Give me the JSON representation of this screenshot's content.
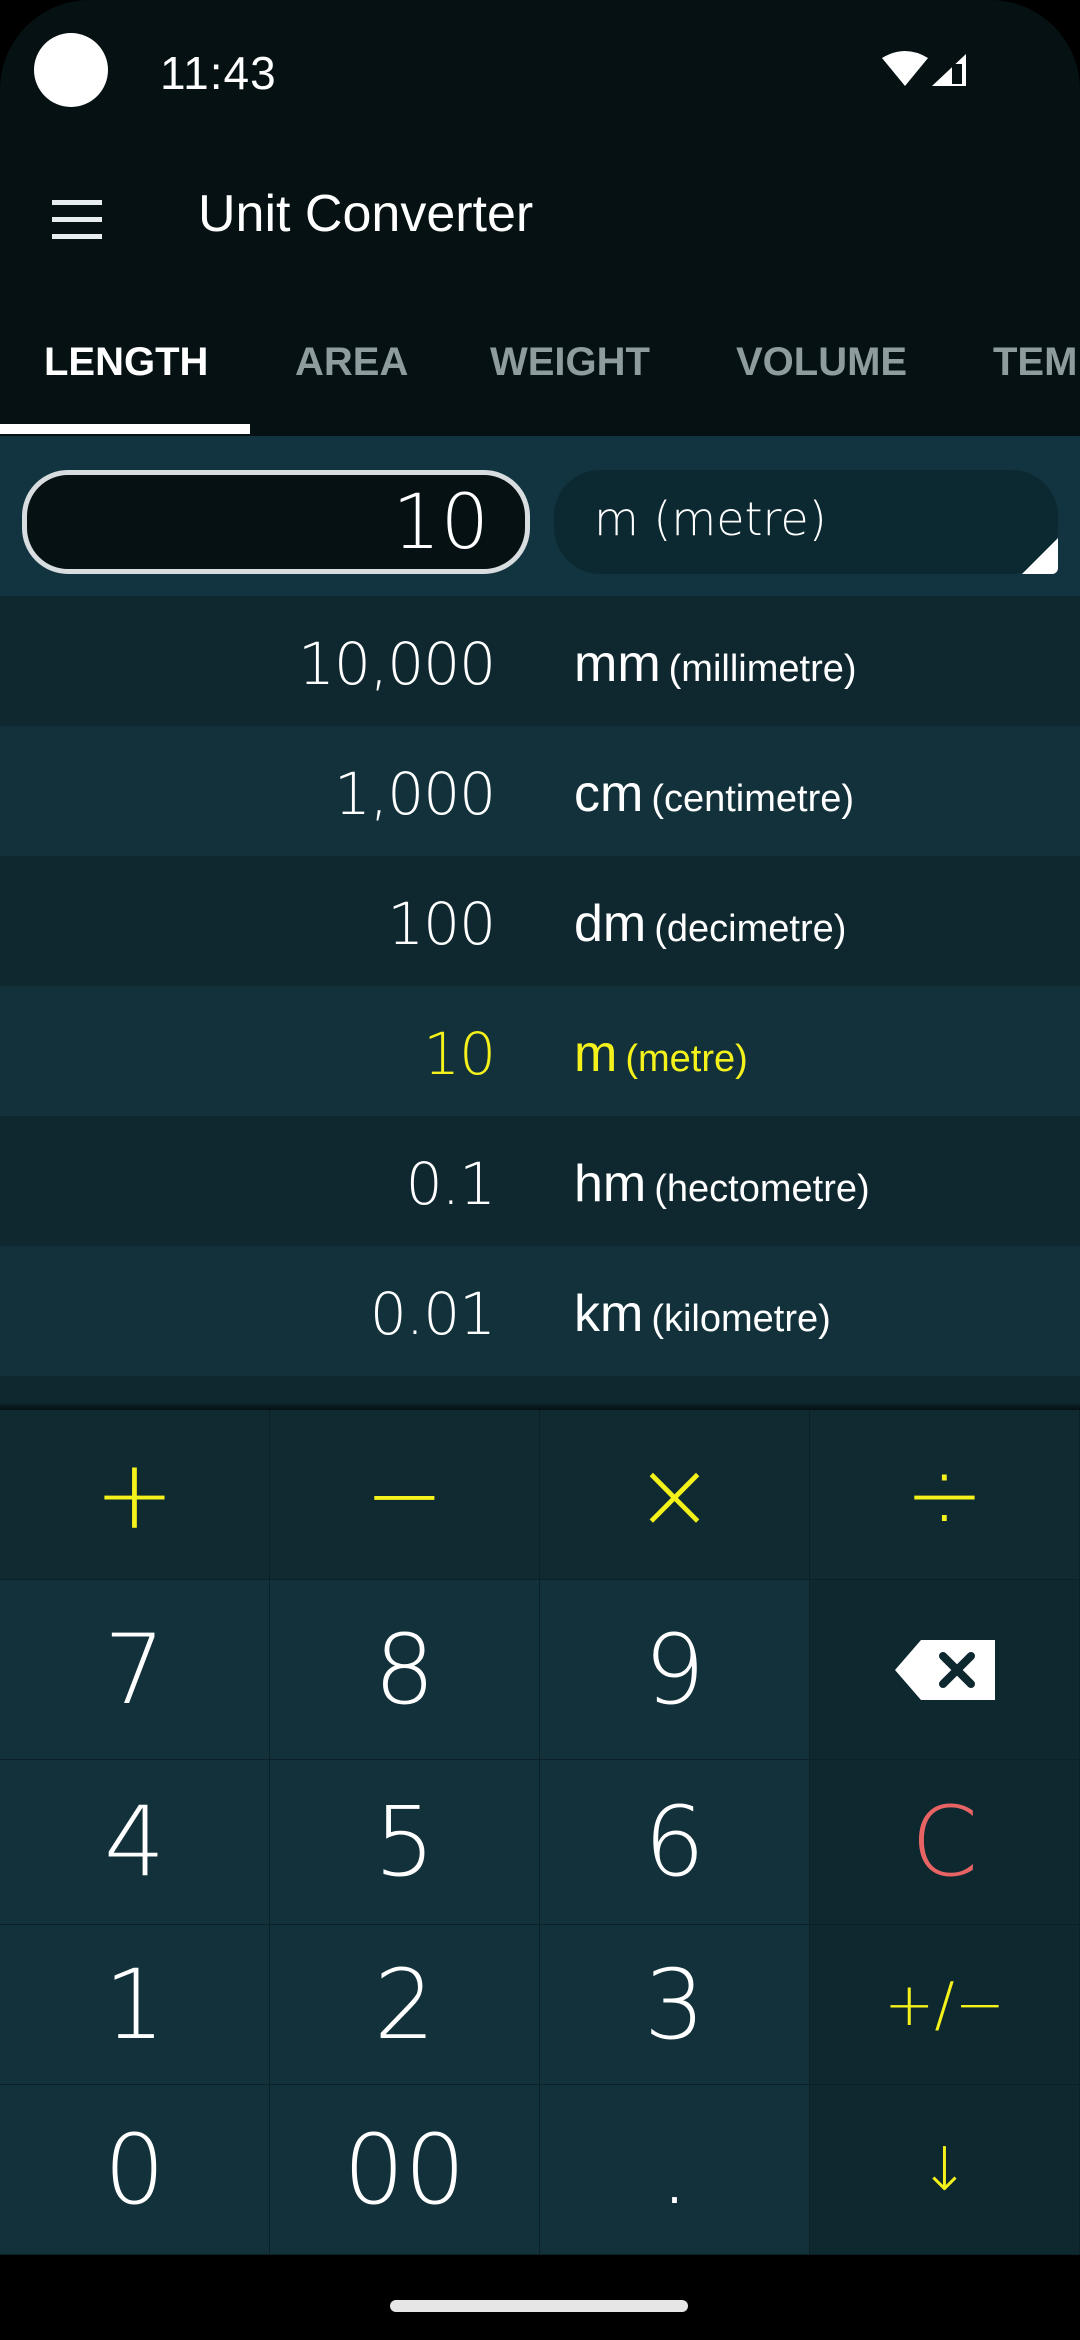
{
  "status_bar": {
    "time": "11:43",
    "icons": [
      "camera-cutout",
      "wifi-icon",
      "cell-signal-icon"
    ]
  },
  "app_bar": {
    "menu_icon": "menu-icon",
    "title": "Unit Converter"
  },
  "tabs": [
    {
      "label": "LENGTH",
      "active": true
    },
    {
      "label": "AREA",
      "active": false
    },
    {
      "label": "WEIGHT",
      "active": false
    },
    {
      "label": "VOLUME",
      "active": false
    },
    {
      "label": "TEM",
      "active": false
    }
  ],
  "input": {
    "value": "10",
    "unit_selected": "m (metre)"
  },
  "results": [
    {
      "value": "10,000",
      "abbr": "mm",
      "name": "(millimetre)",
      "selected": false
    },
    {
      "value": "1,000",
      "abbr": "cm",
      "name": "(centimetre)",
      "selected": false
    },
    {
      "value": "100",
      "abbr": "dm",
      "name": "(decimetre)",
      "selected": false
    },
    {
      "value": "10",
      "abbr": "m",
      "name": "(metre)",
      "selected": true
    },
    {
      "value": "0.1",
      "abbr": "hm",
      "name": "(hectometre)",
      "selected": false
    },
    {
      "value": "0.01",
      "abbr": "km",
      "name": "(kilometre)",
      "selected": false
    }
  ],
  "keypad": {
    "operators": [
      "+",
      "−",
      "×",
      "÷"
    ],
    "rows": [
      [
        "7",
        "8",
        "9",
        "backspace"
      ],
      [
        "4",
        "5",
        "6",
        "C"
      ],
      [
        "1",
        "2",
        "3",
        "+/−"
      ],
      [
        "0",
        "00",
        ".",
        "↓"
      ]
    ],
    "backspace_icon": "backspace-icon"
  },
  "colors": {
    "accent_yellow": "#f5f21b",
    "clear_red": "#e86464",
    "background_dark": "#061114",
    "list_row_dark": "#0f2830",
    "list_row_light": "#12313b"
  }
}
